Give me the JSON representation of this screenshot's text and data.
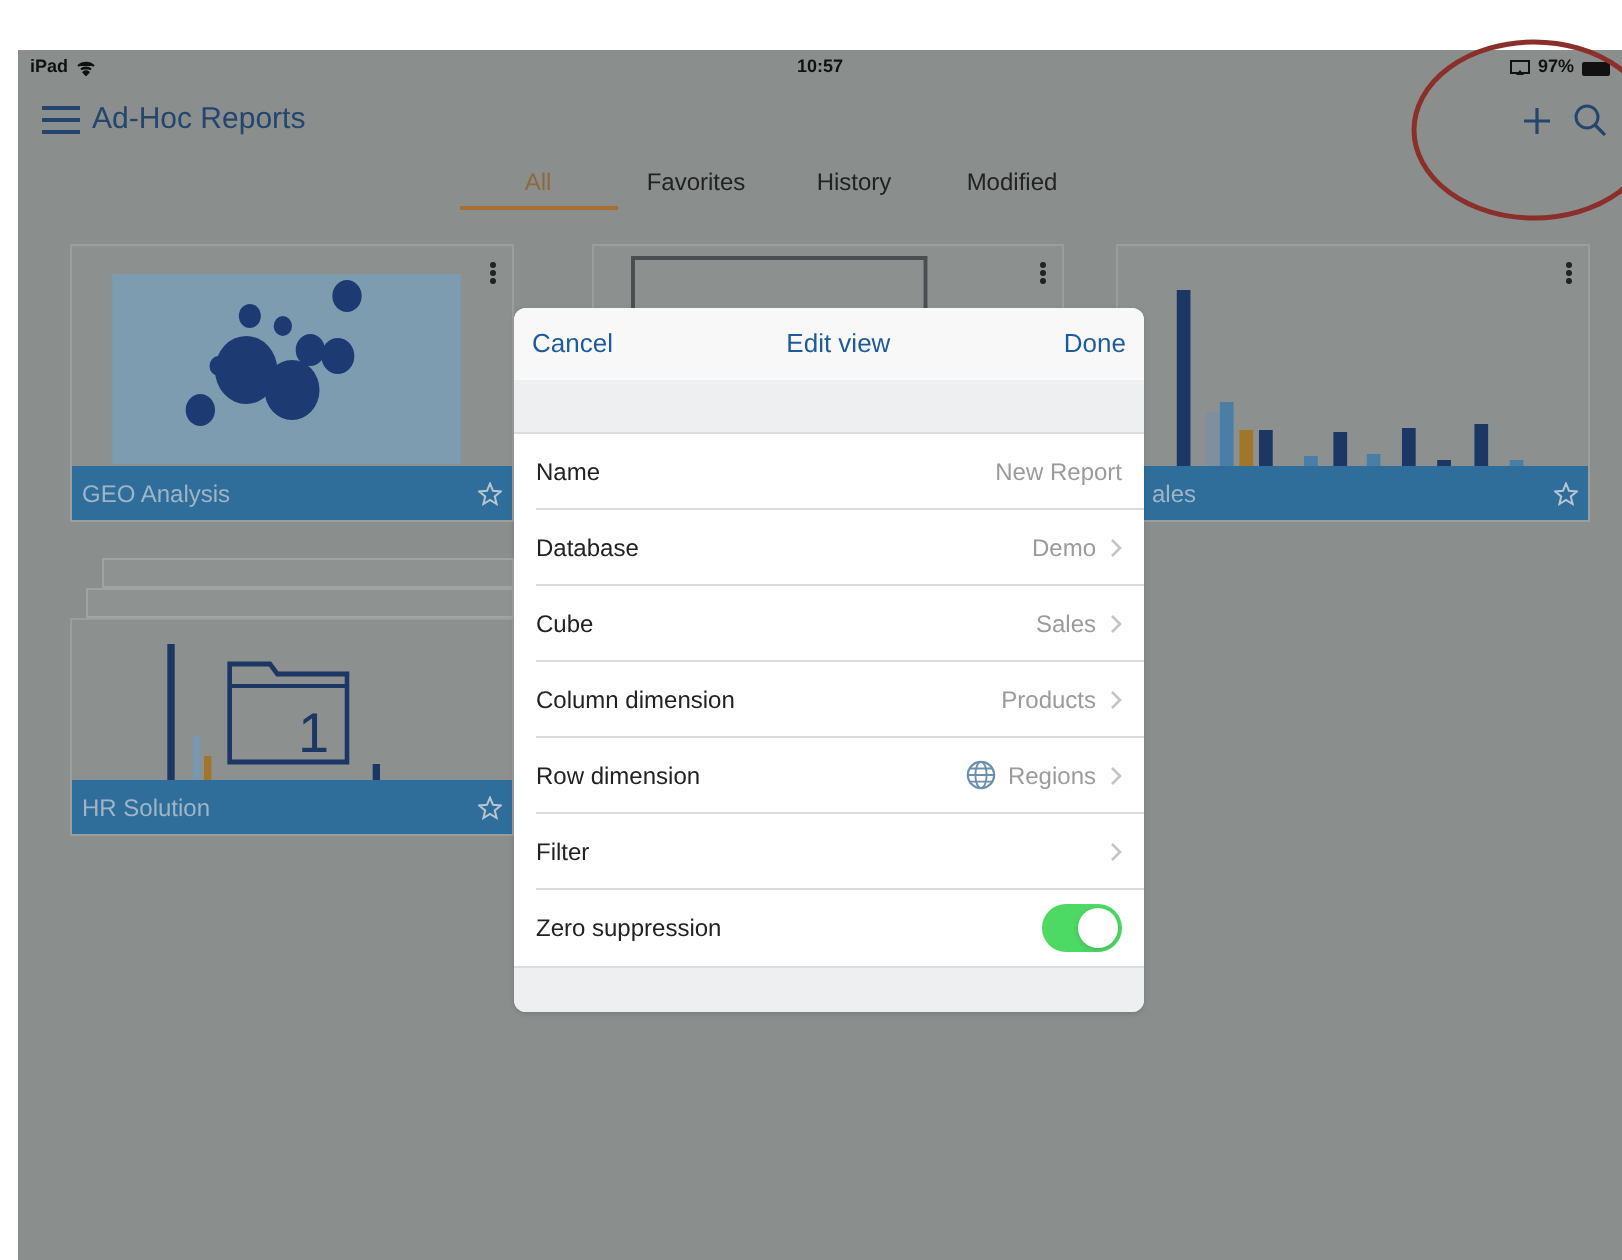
{
  "status_bar": {
    "carrier": "iPad",
    "time": "10:57",
    "battery": "97%"
  },
  "nav": {
    "title": "Ad-Hoc Reports"
  },
  "tabs": [
    {
      "label": "All",
      "selected": true
    },
    {
      "label": "Favorites",
      "selected": false
    },
    {
      "label": "History",
      "selected": false
    },
    {
      "label": "Modified",
      "selected": false
    }
  ],
  "cards": [
    {
      "title": "GEO Analysis",
      "kind": "map",
      "stacked": false
    },
    {
      "kind": "report",
      "stacked": false
    },
    {
      "title": "ales",
      "kind": "bars",
      "stacked": false
    },
    {
      "title": "HR Solution",
      "kind": "folder",
      "stacked": true,
      "folder_number": "1"
    }
  ],
  "dialog": {
    "cancel": "Cancel",
    "title": "Edit view",
    "done": "Done",
    "rows": [
      {
        "label": "Name",
        "value": "New Report",
        "kind": "text"
      },
      {
        "label": "Database",
        "value": "Demo",
        "kind": "link"
      },
      {
        "label": "Cube",
        "value": "Sales",
        "kind": "link"
      },
      {
        "label": "Column dimension",
        "value": "Products",
        "kind": "link"
      },
      {
        "label": "Row dimension",
        "value": "Regions",
        "kind": "link_globe"
      },
      {
        "label": "Filter",
        "kind": "link"
      },
      {
        "label": "Zero suppression",
        "kind": "toggle",
        "on": true
      }
    ]
  }
}
